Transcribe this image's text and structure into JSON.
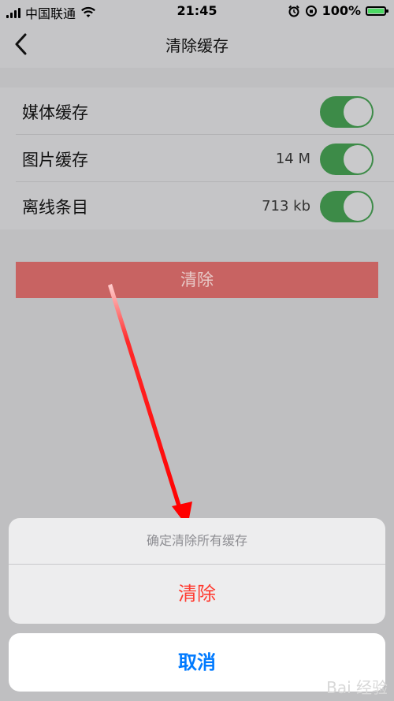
{
  "status_bar": {
    "carrier": "中国联通",
    "time": "21:45",
    "battery": "100%"
  },
  "nav": {
    "title": "清除缓存",
    "back_icon": "chevron-left-icon"
  },
  "settings": [
    {
      "label": "媒体缓存",
      "value": "",
      "enabled": true
    },
    {
      "label": "图片缓存",
      "value": "14 M",
      "enabled": true
    },
    {
      "label": "离线条目",
      "value": "713 kb",
      "enabled": true
    }
  ],
  "clear_button": {
    "label": "清除"
  },
  "action_sheet": {
    "message": "确定清除所有缓存",
    "confirm_label": "清除",
    "cancel_label": "取消"
  },
  "watermark": "Bai 经验",
  "colors": {
    "toggle_on": "#3d8b48",
    "destructive": "#ff3b30",
    "link_blue": "#007aff",
    "clear_button_bg": "#c86362",
    "annotation_arrow": "#ff0000"
  }
}
